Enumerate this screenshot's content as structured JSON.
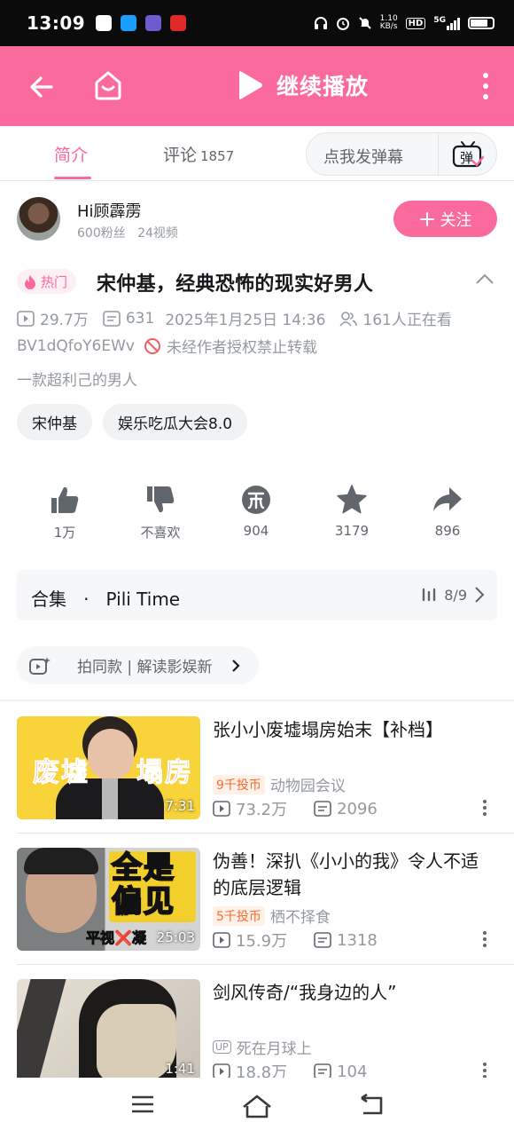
{
  "status_bar": {
    "time": "13:09",
    "net_speed_value": "1.10",
    "net_speed_unit": "KB/s",
    "hd": "HD",
    "network": "5G",
    "icons": [
      "headphones-icon",
      "alarm-icon",
      "mute-icon",
      "signal-icon",
      "battery-icon"
    ]
  },
  "top_bar": {
    "play_label": "继续播放",
    "color": "#fb6a9d",
    "icons": [
      "back-arrow-icon",
      "home-icon",
      "play-icon",
      "more-vertical-icon"
    ]
  },
  "tabs": {
    "intro": "简介",
    "comments": "评论",
    "comments_count": "1857",
    "danmaku_placeholder": "点我发弹幕",
    "danmaku_icon_text": "弹"
  },
  "uploader": {
    "name": "Hi顾霹雳",
    "fans": "600粉丝",
    "videos": "24视频",
    "follow_label": "关注"
  },
  "video": {
    "hot_badge": "热门",
    "title": "宋仲基，经典恐怖的现实好男人",
    "views": "29.7万",
    "danmaku_count": "631",
    "date": "2025年1月25日 14:36",
    "watching": "161人正在看",
    "bvid": "BV1dQfoY6EWv",
    "no_repost": "未经作者授权禁止转载",
    "description": "一款超利己的男人",
    "tags": [
      "宋仲基",
      "娱乐吃瓜大会8.0"
    ]
  },
  "actions": [
    {
      "icon": "thumb-up-icon",
      "label": "1万"
    },
    {
      "icon": "thumb-down-icon",
      "label": "不喜欢"
    },
    {
      "icon": "coin-icon",
      "label": "904"
    },
    {
      "icon": "star-icon",
      "label": "3179"
    },
    {
      "icon": "share-icon",
      "label": "896"
    }
  ],
  "collection": {
    "label": "合集",
    "dot": "·",
    "name": "Pili Time",
    "progress": "8/9"
  },
  "same_style": {
    "text": "拍同款 | 解读影娱新"
  },
  "recommended": [
    {
      "title": "张小小废墟塌房始末【补档】",
      "duration": "7:31",
      "thumb_text_left": "废墟",
      "thumb_text_right": "塌房",
      "coin_badge": "9千投币",
      "up_name": "动物园会议",
      "views": "73.2万",
      "danmaku": "2096"
    },
    {
      "title": "伪善！深扒《小小的我》令人不适的底层逻辑",
      "duration": "25:03",
      "thumb_text_line1": "全是",
      "thumb_text_line2": "偏见",
      "thumb_text_bottom": "平视❌凝",
      "coin_badge": "5千投币",
      "up_name": "栖不择食",
      "views": "15.9万",
      "danmaku": "1318"
    },
    {
      "title": "剑风传奇/“我身边的人”",
      "duration": "1:41",
      "up_badge": "UP",
      "up_name": "死在月球上",
      "views": "18.8万",
      "danmaku": "104"
    }
  ],
  "nav_bar": {
    "icons": [
      "menu-icon",
      "home-nav-icon",
      "back-nav-icon"
    ]
  }
}
